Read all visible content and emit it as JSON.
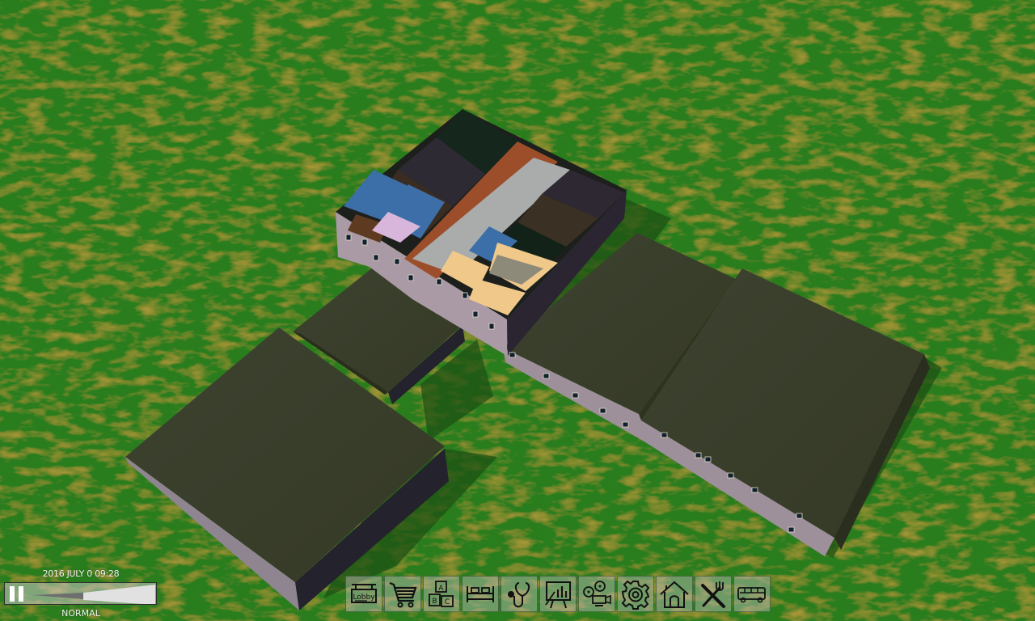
{
  "game": {
    "date_time": "2016 JULY 0 09:28",
    "speed_mode": "NORMAL",
    "paused": false
  },
  "colors": {
    "grass": "#2a7a1f",
    "roof": "#3a3e2a",
    "wall_light": "#a89aa3",
    "wall_dark": "#2b2630",
    "corridor": "#a8aaaa",
    "room_blue": "#3c6ea8",
    "room_peach": "#f0c88a",
    "room_lavender": "#d8b6dc",
    "room_rust": "#a4532c",
    "ui_panel": "#c8c8c8"
  },
  "toolbar": {
    "buttons": [
      {
        "id": "lobby",
        "label": "Lobby",
        "icon": "lobby-sign-icon"
      },
      {
        "id": "shop",
        "label": "",
        "icon": "shopping-cart-icon"
      },
      {
        "id": "kids",
        "label": "A B C",
        "icon": "toy-blocks-icon"
      },
      {
        "id": "bedroom",
        "label": "",
        "icon": "bed-icon"
      },
      {
        "id": "medical",
        "label": "",
        "icon": "stethoscope-icon"
      },
      {
        "id": "conference",
        "label": "",
        "icon": "presentation-board-icon"
      },
      {
        "id": "cinema",
        "label": "",
        "icon": "film-projector-icon"
      },
      {
        "id": "settings",
        "label": "",
        "icon": "gear-icon"
      },
      {
        "id": "home",
        "label": "",
        "icon": "house-icon"
      },
      {
        "id": "restaurant",
        "label": "",
        "icon": "fork-knife-icon"
      },
      {
        "id": "transport",
        "label": "",
        "icon": "bus-icon"
      }
    ]
  }
}
